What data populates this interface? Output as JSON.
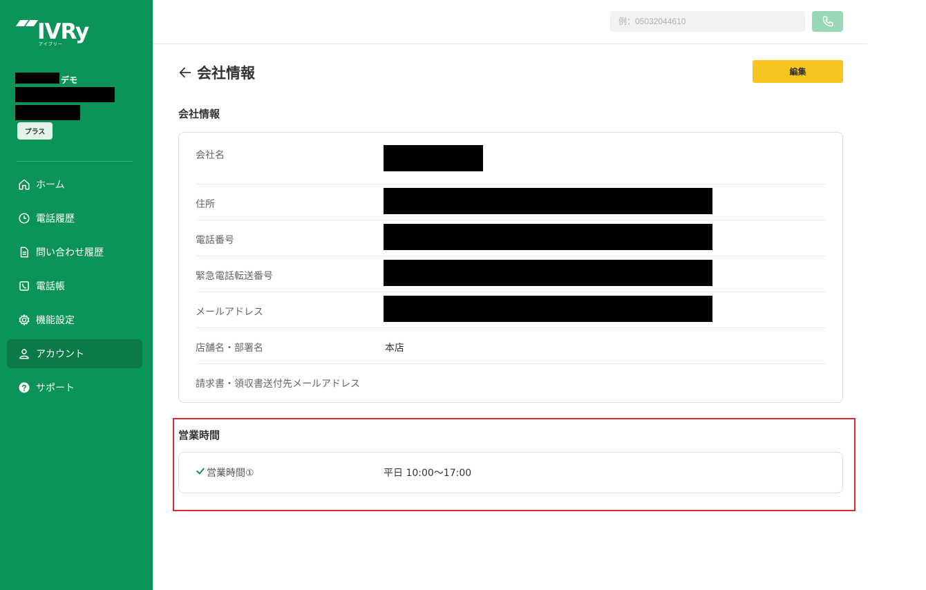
{
  "sidebar": {
    "logo": {
      "text": "IVRy",
      "sub": "アイブリー"
    },
    "account": {
      "demo_label": "デモ",
      "plan_badge": "プラス"
    },
    "nav": [
      {
        "label": "ホーム",
        "icon": "home-icon"
      },
      {
        "label": "電話履歴",
        "icon": "clock-icon"
      },
      {
        "label": "問い合わせ履歴",
        "icon": "document-icon"
      },
      {
        "label": "電話帳",
        "icon": "phonebook-icon"
      },
      {
        "label": "機能設定",
        "icon": "gear-icon"
      },
      {
        "label": "アカウント",
        "icon": "user-icon",
        "active": true
      },
      {
        "label": "サポート",
        "icon": "help-icon"
      }
    ]
  },
  "topbar": {
    "phone_placeholder": "例：05032044610",
    "call_icon": "phone-icon"
  },
  "page": {
    "title": "会社情報",
    "edit_label": "編集"
  },
  "company": {
    "section_title": "会社情報",
    "rows": [
      {
        "label": "会社名"
      },
      {
        "label": "住所"
      },
      {
        "label": "電話番号"
      },
      {
        "label": "緊急電話転送番号"
      },
      {
        "label": "メールアドレス"
      },
      {
        "label": "店舗名・部署名",
        "value": "本店"
      },
      {
        "label": "請求書・領収書送付先メールアドレス",
        "value": ""
      }
    ]
  },
  "hours": {
    "section_title": "営業時間",
    "label": "営業時間①",
    "value": "平日 10:00〜17:00"
  },
  "colors": {
    "sidebar": "#0c9458",
    "accent_button": "#f7c51f",
    "highlight_border": "#e0282e"
  }
}
